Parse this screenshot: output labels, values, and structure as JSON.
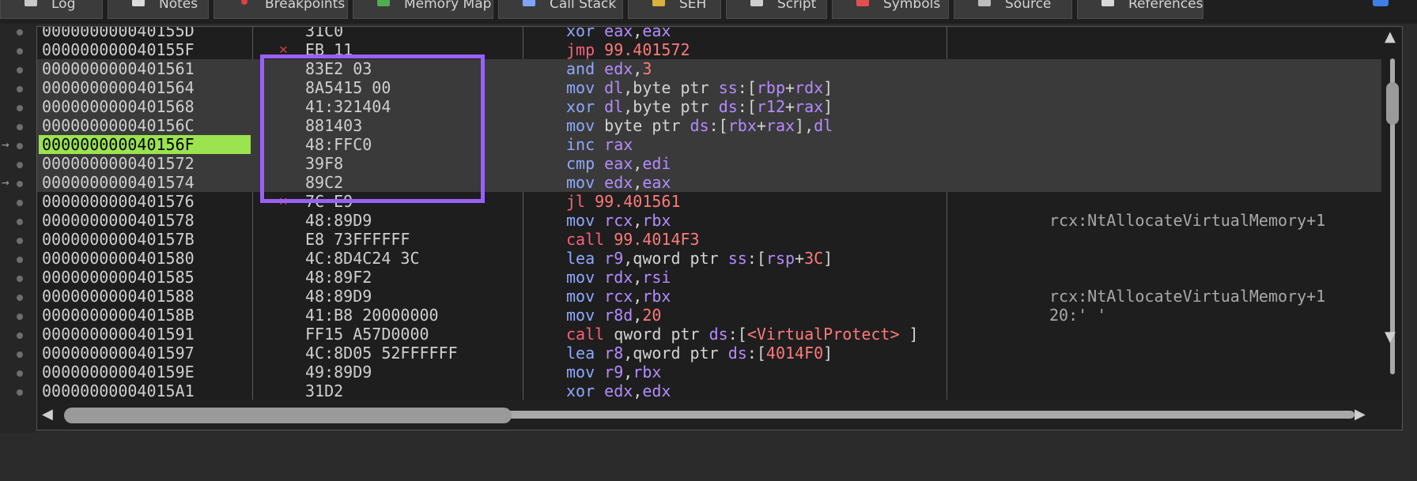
{
  "tabs": [
    {
      "label": "Log",
      "icon": "log-icon"
    },
    {
      "label": "Notes",
      "icon": "notes-icon"
    },
    {
      "label": "Breakpoints",
      "icon": "breakpoint-icon"
    },
    {
      "label": "Memory Map",
      "icon": "memory-map-icon"
    },
    {
      "label": "Call Stack",
      "icon": "call-stack-icon"
    },
    {
      "label": "SEH",
      "icon": "seh-icon"
    },
    {
      "label": "Script",
      "icon": "script-icon"
    },
    {
      "label": "Symbols",
      "icon": "symbols-icon"
    },
    {
      "label": "Source",
      "icon": "source-icon"
    },
    {
      "label": "References",
      "icon": "references-icon"
    }
  ],
  "rows": [
    {
      "addr": "000000000040155D",
      "bytes": "31C0",
      "mn": "xor",
      "ops": [
        [
          "reg",
          "eax"
        ],
        [
          "txt",
          ","
        ],
        [
          "reg",
          "eax"
        ]
      ]
    },
    {
      "addr": "000000000040155F",
      "bytes": "EB 11",
      "mn": "jmp",
      "jump": true,
      "mark": "✕",
      "ops": [
        [
          "num",
          "99.401572"
        ]
      ]
    },
    {
      "addr": "0000000000401561",
      "bytes": "83E2 03",
      "mn": "and",
      "sel": true,
      "ops": [
        [
          "reg",
          "edx"
        ],
        [
          "txt",
          ","
        ],
        [
          "num",
          "3"
        ]
      ]
    },
    {
      "addr": "0000000000401564",
      "bytes": "8A5415 00",
      "mn": "mov",
      "sel": true,
      "ops": [
        [
          "reg",
          "dl"
        ],
        [
          "txt",
          ",byte ptr "
        ],
        [
          "seg",
          "ss"
        ],
        [
          "txt",
          ":["
        ],
        [
          "reg",
          "rbp"
        ],
        [
          "txt",
          "+"
        ],
        [
          "reg",
          "rdx"
        ],
        [
          "txt",
          "]"
        ]
      ]
    },
    {
      "addr": "0000000000401568",
      "bytes": "41:321404",
      "mn": "xor",
      "sel": true,
      "ops": [
        [
          "reg",
          "dl"
        ],
        [
          "txt",
          ",byte ptr "
        ],
        [
          "seg",
          "ds"
        ],
        [
          "txt",
          ":["
        ],
        [
          "reg",
          "r12"
        ],
        [
          "txt",
          "+"
        ],
        [
          "reg",
          "rax"
        ],
        [
          "txt",
          "]"
        ]
      ]
    },
    {
      "addr": "000000000040156C",
      "bytes": "881403",
      "mn": "mov",
      "sel": true,
      "ops": [
        [
          "txt",
          "byte ptr "
        ],
        [
          "seg",
          "ds"
        ],
        [
          "txt",
          ":["
        ],
        [
          "reg",
          "rbx"
        ],
        [
          "txt",
          "+"
        ],
        [
          "reg",
          "rax"
        ],
        [
          "txt",
          "],"
        ],
        [
          "reg",
          "dl"
        ]
      ]
    },
    {
      "addr": "000000000040156F",
      "bytes": "48:FFC0",
      "mn": "inc",
      "sel": true,
      "cur": true,
      "ops": [
        [
          "reg",
          "rax"
        ]
      ]
    },
    {
      "addr": "0000000000401572",
      "bytes": "39F8",
      "mn": "cmp",
      "sel": true,
      "ops": [
        [
          "reg",
          "eax"
        ],
        [
          "txt",
          ","
        ],
        [
          "reg",
          "edi"
        ]
      ]
    },
    {
      "addr": "0000000000401574",
      "bytes": "89C2",
      "mn": "mov",
      "sel": true,
      "ops": [
        [
          "reg",
          "edx"
        ],
        [
          "txt",
          ","
        ],
        [
          "reg",
          "eax"
        ]
      ]
    },
    {
      "addr": "0000000000401576",
      "bytes": "7C E9",
      "mn": "jl",
      "jump": true,
      "mark": "✕",
      "ops": [
        [
          "num",
          "99.401561"
        ]
      ]
    },
    {
      "addr": "0000000000401578",
      "bytes": "48:89D9",
      "mn": "mov",
      "ops": [
        [
          "reg",
          "rcx"
        ],
        [
          "txt",
          ","
        ],
        [
          "reg",
          "rbx"
        ]
      ],
      "cmt": "rcx:NtAllocateVirtualMemory+1"
    },
    {
      "addr": "000000000040157B",
      "bytes": "E8 73FFFFFF",
      "mn": "call",
      "jump": true,
      "ops": [
        [
          "num",
          "99.4014F3"
        ]
      ]
    },
    {
      "addr": "0000000000401580",
      "bytes": "4C:8D4C24 3C",
      "mn": "lea",
      "ops": [
        [
          "reg",
          "r9"
        ],
        [
          "txt",
          ",qword ptr "
        ],
        [
          "seg",
          "ss"
        ],
        [
          "txt",
          ":["
        ],
        [
          "reg",
          "rsp"
        ],
        [
          "txt",
          "+"
        ],
        [
          "num",
          "3C"
        ],
        [
          "txt",
          "]"
        ]
      ]
    },
    {
      "addr": "0000000000401585",
      "bytes": "48:89F2",
      "mn": "mov",
      "ops": [
        [
          "reg",
          "rdx"
        ],
        [
          "txt",
          ","
        ],
        [
          "reg",
          "rsi"
        ]
      ]
    },
    {
      "addr": "0000000000401588",
      "bytes": "48:89D9",
      "mn": "mov",
      "ops": [
        [
          "reg",
          "rcx"
        ],
        [
          "txt",
          ","
        ],
        [
          "reg",
          "rbx"
        ]
      ],
      "cmt": "rcx:NtAllocateVirtualMemory+1"
    },
    {
      "addr": "000000000040158B",
      "bytes": "41:B8 20000000",
      "mn": "mov",
      "ops": [
        [
          "reg",
          "r8d"
        ],
        [
          "txt",
          ","
        ],
        [
          "num",
          "20"
        ]
      ],
      "cmt": "20:' '"
    },
    {
      "addr": "0000000000401591",
      "bytes": "FF15 A57D0000",
      "mn": "call",
      "jump": true,
      "ops": [
        [
          "txt",
          "qword ptr "
        ],
        [
          "seg",
          "ds"
        ],
        [
          "txt",
          ":["
        ],
        [
          "sym",
          "<VirtualProtect>"
        ],
        [
          "txt",
          " ]"
        ]
      ]
    },
    {
      "addr": "0000000000401597",
      "bytes": "4C:8D05 52FFFFFF",
      "mn": "lea",
      "ops": [
        [
          "reg",
          "r8"
        ],
        [
          "txt",
          ",qword ptr "
        ],
        [
          "seg",
          "ds"
        ],
        [
          "txt",
          ":["
        ],
        [
          "num",
          "4014F0"
        ],
        [
          "txt",
          "]"
        ]
      ]
    },
    {
      "addr": "000000000040159E",
      "bytes": "49:89D9",
      "mn": "mov",
      "ops": [
        [
          "reg",
          "r9"
        ],
        [
          "txt",
          ","
        ],
        [
          "reg",
          "rbx"
        ]
      ]
    },
    {
      "addr": "00000000004015A1",
      "bytes": "31D2",
      "mn": "xor",
      "ops": [
        [
          "reg",
          "edx"
        ],
        [
          "txt",
          ","
        ],
        [
          "reg",
          "edx"
        ]
      ]
    }
  ],
  "colors": {
    "accent_selection": "#9a60ff",
    "current_address": "#9be34f",
    "mnemonic": "#8fa8ff",
    "jump_mnemonic": "#ff5e7e",
    "register": "#b48cff",
    "number": "#ff7a7a"
  },
  "scroll": {
    "horizontal_position": 0.0,
    "vertical_position": 0.1
  }
}
